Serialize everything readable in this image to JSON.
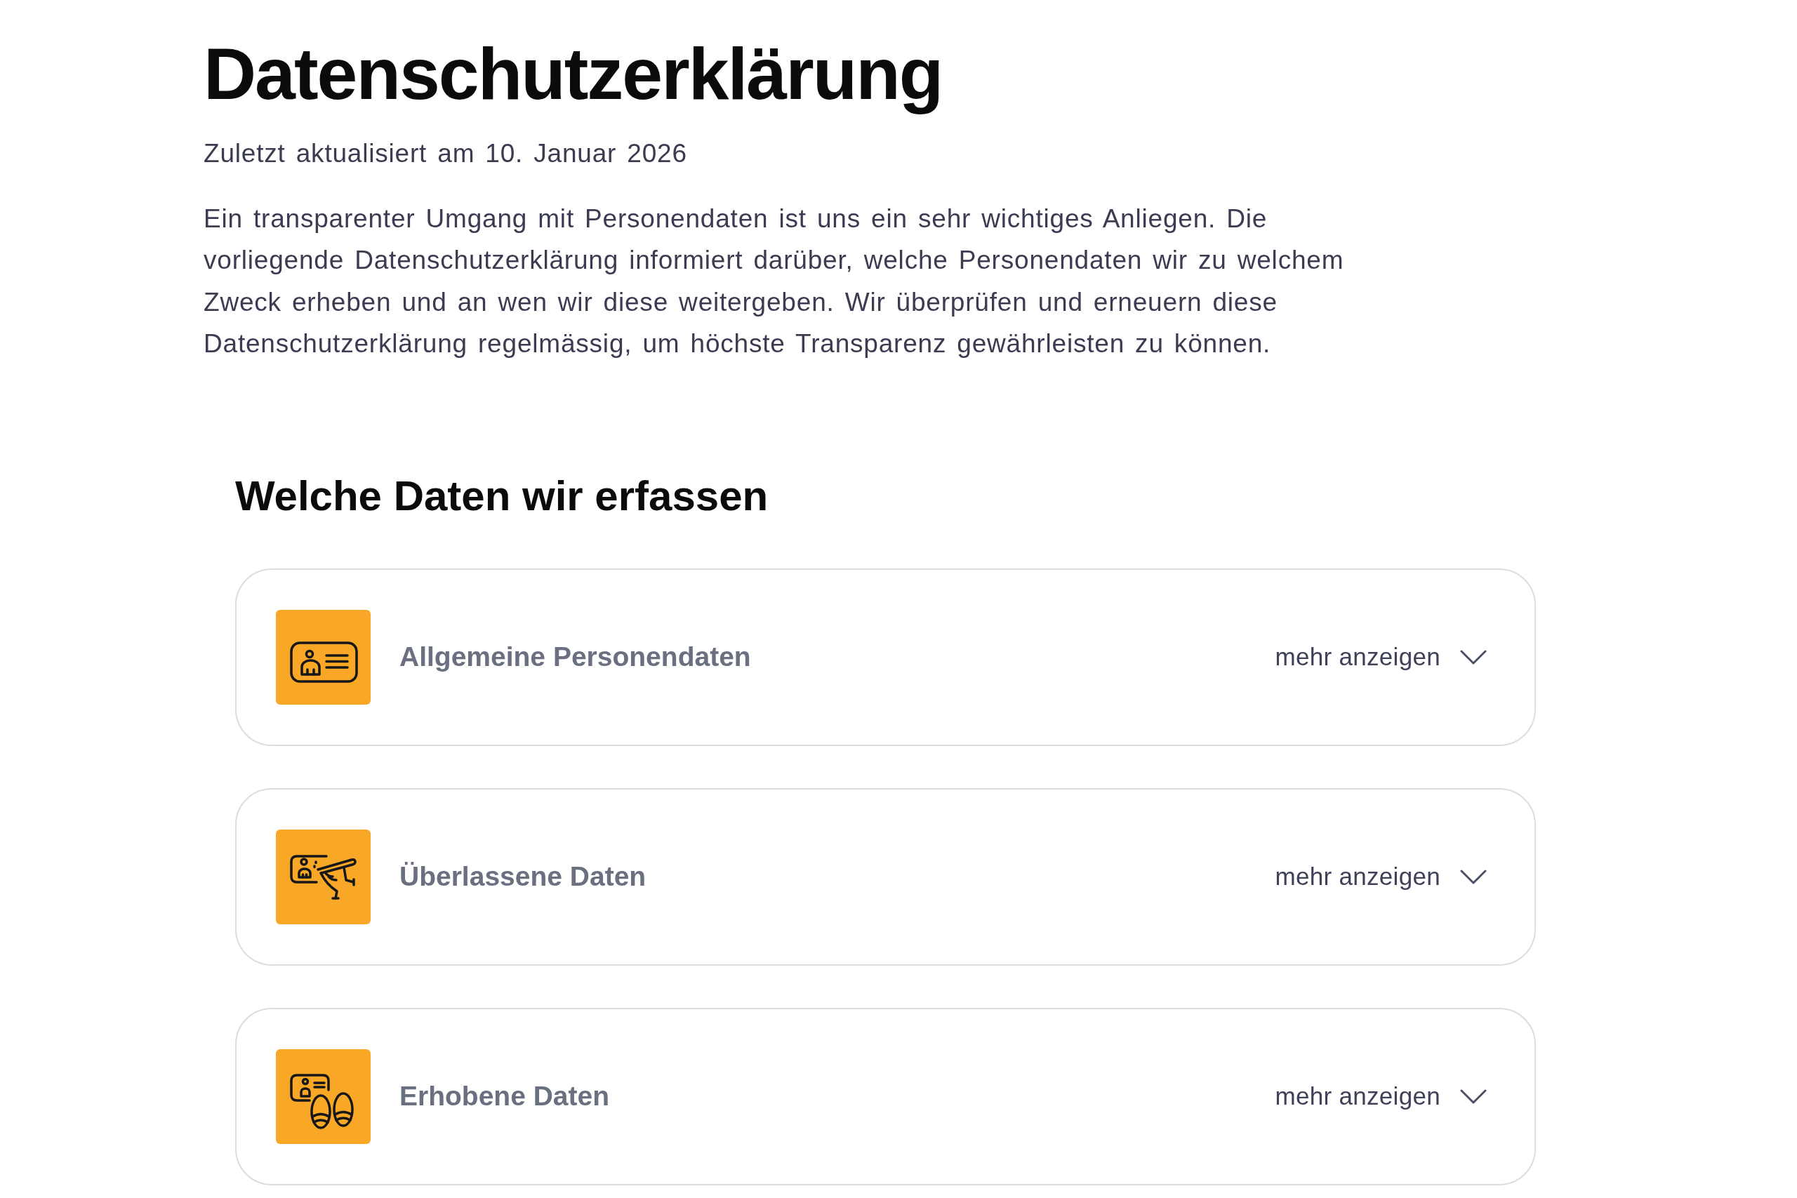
{
  "header": {
    "title": "Datenschutzerklärung",
    "updated": "Zuletzt aktualisiert am 10. Januar 2026",
    "intro": "Ein transparenter Umgang mit Personendaten ist uns ein sehr wichtiges Anliegen. Die vorliegende Datenschutzerklärung informiert darüber, welche Personendaten wir zu welchem Zweck erheben und an wen wir diese weitergeben. Wir überprüfen und erneuern diese Datenschutzerklärung regelmässig, um höchste Transparenz gewährleisten zu können."
  },
  "section": {
    "heading": "Welche Daten wir erfassen",
    "items": [
      {
        "title": "Allgemeine Personendaten",
        "toggle": "mehr anzeigen",
        "expanded": false
      },
      {
        "title": "Überlassene Daten",
        "toggle": "mehr anzeigen",
        "expanded": false
      },
      {
        "title": "Erhobene Daten",
        "toggle": "mehr anzeigen",
        "expanded": false
      }
    ]
  }
}
